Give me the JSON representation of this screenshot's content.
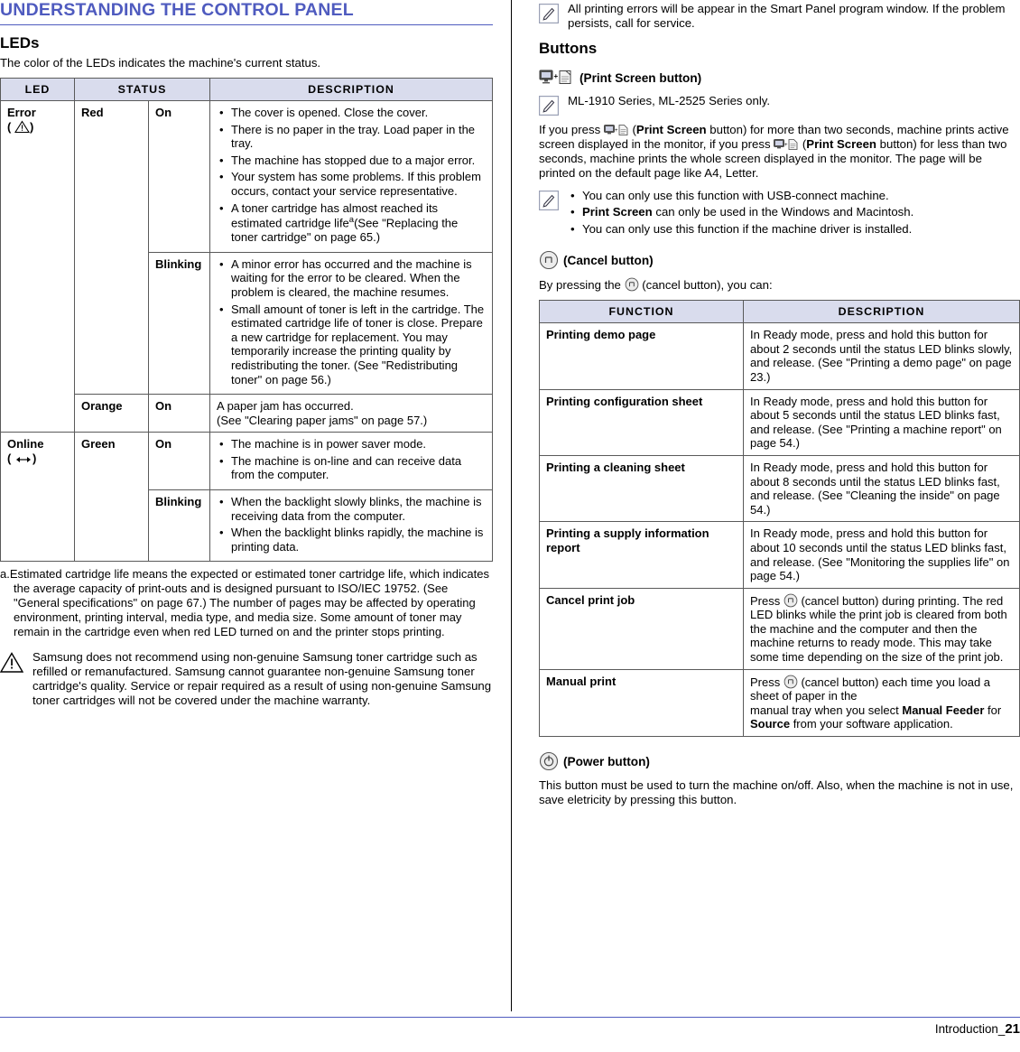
{
  "left": {
    "section_title": "UNDERSTANDING THE CONTROL PANEL",
    "leds": {
      "heading": "LEDs",
      "intro": "The color of the LEDs indicates the machine's current status.",
      "columns": [
        "LED",
        "STATUS",
        "DESCRIPTION"
      ],
      "rows": [
        {
          "led": "Error",
          "led_icon": "warning-triangle-icon",
          "color": "Red",
          "status": "On",
          "bullets": [
            "The cover is opened. Close the cover.",
            "There is no paper in the tray. Load paper in the tray.",
            "The machine has stopped due to a major error.",
            "Your system has some problems. If this problem occurs, contact your service representative.",
            "A toner cartridge has almost reached its estimated cartridge life"
          ],
          "bullet5_sup": "a",
          "bullet5_tail": "(See \"Replacing the toner cartridge\" on page 65.)"
        },
        {
          "status": "Blinking",
          "bullets": [
            "A minor error has occurred and the machine is waiting for the error to be cleared. When the problem is cleared, the machine resumes.",
            "Small amount of toner is left in the cartridge. The estimated cartridge life of toner is close. Prepare a new cartridge for replacement. You may temporarily increase the printing quality by redistributing the toner. (See \"Redistributing toner\" on page 56.)"
          ]
        },
        {
          "color": "Orange",
          "status": "On",
          "plain": "A paper jam has occurred.\n(See \"Clearing paper jams\" on page 57.)"
        },
        {
          "led": "Online",
          "led_icon": "online-arrows-icon",
          "color": "Green",
          "status": "On",
          "bullets": [
            "The machine is in power saver mode.",
            "The machine is on-line and can receive data from the computer."
          ]
        },
        {
          "status": "Blinking",
          "bullets": [
            "When the backlight slowly blinks, the machine is receiving data from the computer.",
            "When the backlight blinks rapidly, the machine is printing data."
          ]
        }
      ],
      "footnote_label": "a.",
      "footnote_text": "Estimated cartridge life means the expected or estimated toner cartridge life, which indicates the average capacity of print-outs and is designed pursuant to ISO/IEC 19752. (See \"General specifications\" on page 67.) The number of pages may be affected by operating environment, printing interval, media type, and media size. Some amount of toner may remain in the cartridge even when red LED turned on and the printer stops printing."
    },
    "warning_note": "Samsung does not recommend using non-genuine Samsung toner cartridge such as refilled or remanufactured. Samsung cannot guarantee non-genuine Samsung toner cartridge's quality. Service or repair required as a result of using non-genuine Samsung toner cartridges will not be covered under the machine warranty."
  },
  "right": {
    "top_note": "All printing errors will be appear in the Smart Panel program window. If the problem persists, call for service.",
    "buttons_heading": "Buttons",
    "print_screen": {
      "head_label": "(Print Screen button)",
      "note": "ML-1910 Series, ML-2525 Series only.",
      "para_1a": "If you press ",
      "para_1b": " (",
      "print_screen_bold": "Print Screen",
      "para_1c": " button) for more than two seconds, machine prints active screen displayed in the monitor, if you press ",
      "para_1d": " (",
      "para_1e": " button) for less than two seconds, machine prints the whole screen displayed in the monitor. The page will be printed on the default page like A4, Letter.",
      "note_bullets": [
        "You can only use this function with USB-connect machine.",
        "Print Screen can only be used in the Windows and Macintosh.",
        "You can only use this function if the machine driver is installed."
      ],
      "note_bullet2_bold": "Print Screen",
      "note_bullet2_rest": " can only be used in the Windows and Macintosh."
    },
    "cancel": {
      "head_label": "(Cancel button)",
      "intro_a": "By pressing the ",
      "intro_b": " (cancel button), you can:",
      "columns": [
        "FUNCTION",
        "DESCRIPTION"
      ],
      "rows": [
        {
          "function": "Printing demo page",
          "description": "In Ready mode, press and hold this button for about 2 seconds until the status LED blinks slowly, and release. (See \"Printing a demo page\" on page 23.)"
        },
        {
          "function": "Printing configuration sheet",
          "description": "In Ready mode, press and hold this button for about 5 seconds until the status LED blinks fast, and release. (See \"Printing a machine report\" on page 54.)"
        },
        {
          "function": "Printing a cleaning sheet",
          "description": "In Ready mode, press and hold this button for about 8 seconds until the status LED blinks fast, and release. (See \"Cleaning the inside\" on page 54.)"
        },
        {
          "function": "Printing a supply information report",
          "description": "In Ready mode, press and hold this button for about 10 seconds until the status LED blinks fast, and release. (See \"Monitoring the supplies life\" on page 54.)"
        },
        {
          "function": "Cancel print job",
          "description_a": "Press ",
          "description_b": " (cancel button) during printing. The red LED blinks while the print job is cleared from both the machine and the computer and then the machine returns to ready mode. This may take some time depending on the size of the print job."
        },
        {
          "function": "Manual print",
          "description_a": "Press ",
          "description_b": " (cancel button) each time you load a sheet of paper in the",
          "description_c": "manual tray when you select ",
          "bold_1": "Manual Feeder",
          "description_d": " for ",
          "bold_2": "Source",
          "description_e": " from your software application."
        }
      ]
    },
    "power": {
      "head_label": "(Power button)",
      "text": "This button must be used to turn the machine on/off. Also, when the machine is not in use, save eletricity by pressing this button."
    }
  },
  "footer": {
    "label": "Introduction_",
    "page": "21"
  },
  "colors": {
    "accent": "#4f5bbf",
    "table_header_bg": "#d9dced"
  }
}
